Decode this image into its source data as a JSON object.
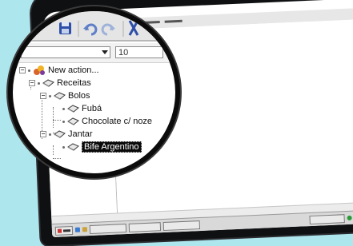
{
  "tree": {
    "items": [
      {
        "label": "New action...",
        "icon": "action-icon",
        "selected": false
      },
      {
        "label": "Receitas",
        "icon": "book-icon",
        "selected": false
      },
      {
        "label": "Bolos",
        "icon": "book-icon",
        "selected": false
      },
      {
        "label": "Fubá",
        "icon": "book-icon",
        "selected": false
      },
      {
        "label": "Chocolate c/ noze",
        "icon": "book-icon",
        "selected": false
      },
      {
        "label": "Jantar",
        "icon": "book-icon",
        "selected": false
      },
      {
        "label": "Bife Argentino",
        "icon": "book-icon",
        "selected": true
      }
    ]
  },
  "magnified_toolbar": {
    "font_size_value": "10"
  },
  "colors": {
    "page_background": "#aee6ee",
    "frame": "#0f1012",
    "selection": "#0a0a0a"
  }
}
